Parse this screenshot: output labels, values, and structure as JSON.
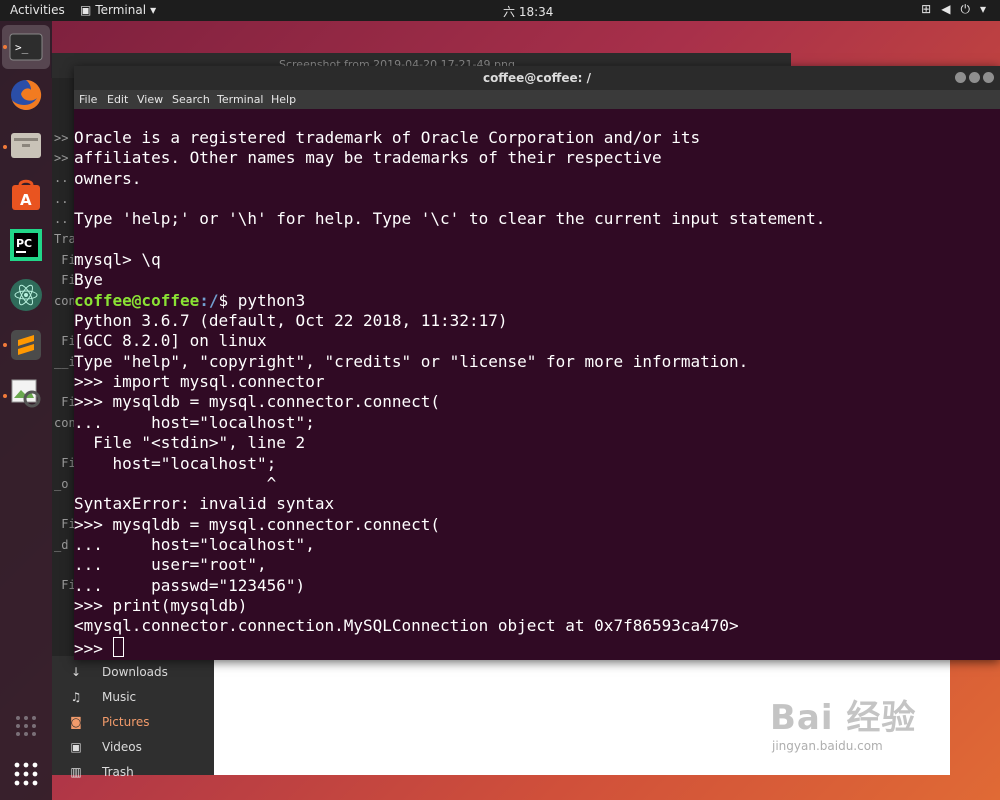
{
  "topbar": {
    "activities": "Activities",
    "app_name": "Terminal",
    "clock": "六 18:34"
  },
  "background_window": {
    "title": "Screenshot from 2019-04-20 17-21-49.png"
  },
  "files_sidebar": [
    {
      "label": "Downloads",
      "icon": "download-icon"
    },
    {
      "label": "Music",
      "icon": "music-icon"
    },
    {
      "label": "Pictures",
      "icon": "camera-icon",
      "selected": true
    },
    {
      "label": "Videos",
      "icon": "video-icon"
    },
    {
      "label": "Trash",
      "icon": "trash-icon"
    }
  ],
  "left_strip_lines": [
    "",
    "",
    ">>",
    ">>",
    "..",
    "..",
    "..",
    "Trac",
    " Fi",
    " Fi",
    "conn",
    "",
    " Fi",
    "__i",
    "",
    " Fi",
    "con",
    "",
    " Fi",
    "_o",
    "",
    " Fi",
    "_d",
    "",
    " Fi"
  ],
  "terminal": {
    "title": "coffee@coffee: /",
    "menu": [
      "File",
      "Edit",
      "View",
      "Search",
      "Terminal",
      "Help"
    ],
    "lines": [
      "Oracle is a registered trademark of Oracle Corporation and/or its",
      "affiliates. Other names may be trademarks of their respective",
      "owners.",
      "",
      "Type 'help;' or '\\h' for help. Type '\\c' to clear the current input statement.",
      "",
      "mysql> \\q",
      "Bye",
      "__PROMPT__",
      "Python 3.6.7 (default, Oct 22 2018, 11:32:17)",
      "[GCC 8.2.0] on linux",
      "Type \"help\", \"copyright\", \"credits\" or \"license\" for more information.",
      ">>> import mysql.connector",
      ">>> mysqldb = mysql.connector.connect(",
      "...     host=\"localhost\";",
      "  File \"<stdin>\", line 2",
      "    host=\"localhost\";",
      "                    ^",
      "SyntaxError: invalid syntax",
      ">>> mysqldb = mysql.connector.connect(",
      "...     host=\"localhost\",",
      "...     user=\"root\",",
      "...     passwd=\"123456\")",
      ">>> print(mysqldb)",
      "<mysql.connector.connection.MySQLConnection object at 0x7f86593ca470>"
    ],
    "prompt_user": "coffee@coffee",
    "prompt_path": ":/",
    "prompt_cmd": "$ python3",
    "final_prompt": ">>> "
  },
  "watermark": {
    "brand": "Bai 经验",
    "url": "jingyan.baidu.com"
  },
  "colors": {
    "terminal_bg": "#300a24",
    "prompt_user": "#8ae234",
    "prompt_path": "#729fcf",
    "accent": "#e95420"
  }
}
